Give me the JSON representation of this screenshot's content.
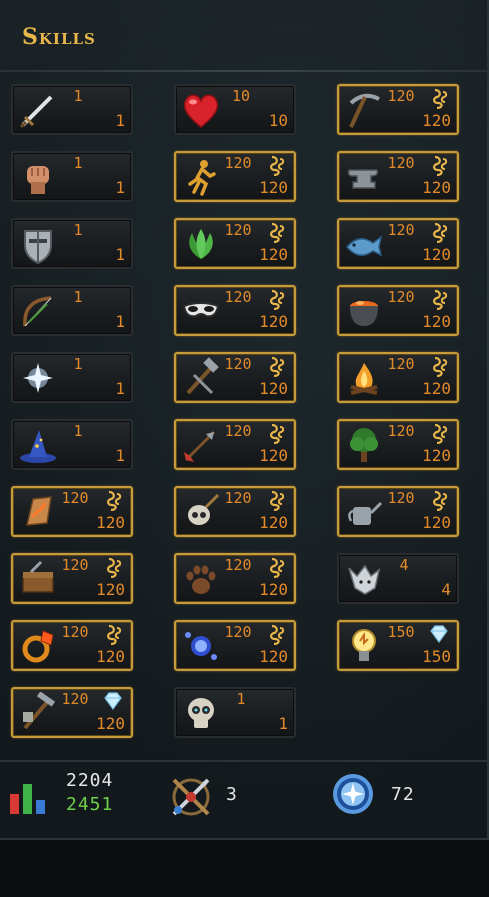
{
  "title": "Skills",
  "skills": [
    {
      "name": "attack",
      "icon": "sword-icon",
      "top": "1",
      "bottom": "1",
      "badge": "none",
      "gold": false
    },
    {
      "name": "constitution",
      "icon": "heart-icon",
      "top": "10",
      "bottom": "10",
      "badge": "none",
      "gold": false
    },
    {
      "name": "mining",
      "icon": "pickaxe-icon",
      "top": "120",
      "bottom": "120",
      "badge": "mastery",
      "gold": true
    },
    {
      "name": "strength",
      "icon": "fist-icon",
      "top": "1",
      "bottom": "1",
      "badge": "none",
      "gold": false
    },
    {
      "name": "agility",
      "icon": "running-man-icon",
      "top": "120",
      "bottom": "120",
      "badge": "mastery",
      "gold": true
    },
    {
      "name": "smithing",
      "icon": "anvil-icon",
      "top": "120",
      "bottom": "120",
      "badge": "mastery",
      "gold": true
    },
    {
      "name": "defence",
      "icon": "shield-icon",
      "top": "1",
      "bottom": "1",
      "badge": "none",
      "gold": false
    },
    {
      "name": "herblore",
      "icon": "herb-leaves-icon",
      "top": "120",
      "bottom": "120",
      "badge": "mastery",
      "gold": true
    },
    {
      "name": "fishing",
      "icon": "fish-icon",
      "top": "120",
      "bottom": "120",
      "badge": "mastery",
      "gold": true
    },
    {
      "name": "ranged",
      "icon": "bow-icon",
      "top": "1",
      "bottom": "1",
      "badge": "none",
      "gold": false
    },
    {
      "name": "thieving",
      "icon": "mask-icon",
      "top": "120",
      "bottom": "120",
      "badge": "mastery",
      "gold": true
    },
    {
      "name": "cooking",
      "icon": "cauldron-icon",
      "top": "120",
      "bottom": "120",
      "badge": "mastery",
      "gold": true
    },
    {
      "name": "prayer",
      "icon": "prayer-star-icon",
      "top": "1",
      "bottom": "1",
      "badge": "none",
      "gold": false
    },
    {
      "name": "crafting",
      "icon": "chisel-hammer-icon",
      "top": "120",
      "bottom": "120",
      "badge": "mastery",
      "gold": true
    },
    {
      "name": "firemaking",
      "icon": "campfire-icon",
      "top": "120",
      "bottom": "120",
      "badge": "mastery",
      "gold": true
    },
    {
      "name": "magic",
      "icon": "wizard-hat-icon",
      "top": "1",
      "bottom": "1",
      "badge": "none",
      "gold": false
    },
    {
      "name": "fletching",
      "icon": "arrow-icon",
      "top": "120",
      "bottom": "120",
      "badge": "mastery",
      "gold": true
    },
    {
      "name": "woodcutting",
      "icon": "tree-icon",
      "top": "120",
      "bottom": "120",
      "badge": "mastery",
      "gold": true
    },
    {
      "name": "runecrafting",
      "icon": "rune-icon",
      "top": "120",
      "bottom": "120",
      "badge": "mastery",
      "gold": true
    },
    {
      "name": "slayer",
      "icon": "skull-sword-icon",
      "top": "120",
      "bottom": "120",
      "badge": "mastery",
      "gold": true
    },
    {
      "name": "farming",
      "icon": "watering-can-icon",
      "top": "120",
      "bottom": "120",
      "badge": "mastery",
      "gold": true
    },
    {
      "name": "construction",
      "icon": "toolbox-icon",
      "top": "120",
      "bottom": "120",
      "badge": "mastery",
      "gold": true
    },
    {
      "name": "hunter",
      "icon": "paw-print-icon",
      "top": "120",
      "bottom": "120",
      "badge": "mastery",
      "gold": true
    },
    {
      "name": "summoning",
      "icon": "wolf-icon",
      "top": "4",
      "bottom": "4",
      "badge": "none",
      "gold": false
    },
    {
      "name": "dungeoneering",
      "icon": "ring-icon",
      "top": "120",
      "bottom": "120",
      "badge": "mastery",
      "gold": true
    },
    {
      "name": "divination",
      "icon": "energy-orb-icon",
      "top": "120",
      "bottom": "120",
      "badge": "mastery",
      "gold": true
    },
    {
      "name": "invention",
      "icon": "lightbulb-icon",
      "top": "150",
      "bottom": "150",
      "badge": "diamond",
      "gold": true
    },
    {
      "name": "archaeology",
      "icon": "mattock-icon",
      "top": "120",
      "bottom": "120",
      "badge": "diamond",
      "gold": true
    },
    {
      "name": "necromancy",
      "icon": "skull-icon",
      "top": "1",
      "bottom": "1",
      "badge": "none",
      "gold": false
    }
  ],
  "footer": {
    "total_level": "2204",
    "virtual_level": "2451",
    "combat_level": "3",
    "relic_value": "72",
    "stats_icon": "bar-chart-icon",
    "combat_icon": "combat-crossed-weapons-icon",
    "relic_icon": "compass-badge-icon"
  },
  "colors": {
    "title": "#e8b64a",
    "level": "#e28a2a",
    "gold_border": "#c59b3c",
    "virtual": "#6ecf4a"
  }
}
